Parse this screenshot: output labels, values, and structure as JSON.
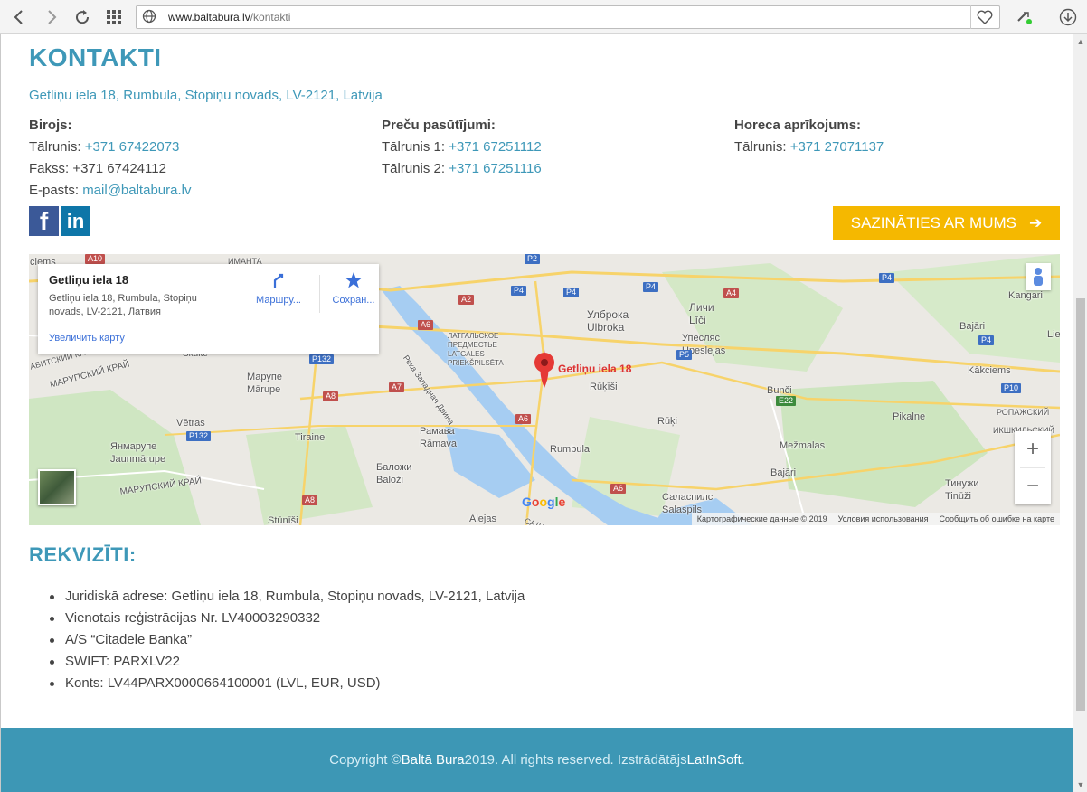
{
  "browser": {
    "url_host": "www.baltabura.lv",
    "url_path": "/kontakti"
  },
  "page": {
    "title": "KONTAKTI",
    "address": "Getliņu iela 18, Rumbula, Stopiņu novads, LV-2121, Latvija",
    "office": {
      "heading": "Birojs:",
      "phone_label": "Tālrunis: ",
      "phone": "+371 67422073",
      "fax": "Fakss: +371 67424112",
      "email_label": "E-pasts: ",
      "email": "mail@baltabura.lv"
    },
    "orders": {
      "heading": "Preču pasūtījumi:",
      "phone1_label": "Tālrunis 1: ",
      "phone1": "+371 67251112",
      "phone2_label": "Tālrunis 2: ",
      "phone2": "+371 67251116"
    },
    "horeca": {
      "heading": "Horeca aprīkojums:",
      "phone_label": "Tālrunis: ",
      "phone": "+371 27071137"
    },
    "social": {
      "facebook": "f",
      "linkedin": "in"
    },
    "contact_button": "SAZINĀTIES AR MUMS",
    "contact_arrow": "➔",
    "map": {
      "card_title": "Getliņu iela 18",
      "card_address": "Getliņu iela 18, Rumbula, Stopiņu novads, LV-2121, Латвия",
      "route_label": "Маршру...",
      "save_label": "Сохран...",
      "enlarge": "Увеличить карту",
      "pin_label": "Getliņu iela 18",
      "zoom_in": "+",
      "zoom_out": "−",
      "google": "Google",
      "footer_data": "Картографические данные © 2019",
      "footer_terms": "Условия использования",
      "footer_report": "Сообщить об ошибке на карте",
      "place_labels": [
        {
          "text": "Личи",
          "key": "p1"
        },
        {
          "text": "Līči",
          "key": "p2"
        },
        {
          "text": "Улброка",
          "key": "p3"
        },
        {
          "text": "Ulbroka",
          "key": "p4"
        },
        {
          "text": "Kangari",
          "key": "p5"
        },
        {
          "text": "Bajāri",
          "key": "p6"
        },
        {
          "text": "Упесляс",
          "key": "p7"
        },
        {
          "text": "Upeslejas",
          "key": "p8"
        },
        {
          "text": "Kākciems",
          "key": "p9"
        },
        {
          "text": "Rūķīši",
          "key": "p10"
        },
        {
          "text": "Rūķi",
          "key": "p11"
        },
        {
          "text": "Bunči",
          "key": "p12"
        },
        {
          "text": "Pikalne",
          "key": "p13"
        },
        {
          "text": "Mežmalas",
          "key": "p14"
        },
        {
          "text": "Bajāri",
          "key": "p15"
        },
        {
          "text": "Rumbula",
          "key": "p16"
        },
        {
          "text": "Рамава",
          "key": "p17"
        },
        {
          "text": "Rāmava",
          "key": "p18"
        },
        {
          "text": "Tiraine",
          "key": "p19"
        },
        {
          "text": "Марупе",
          "key": "p20"
        },
        {
          "text": "Mārupe",
          "key": "p21"
        },
        {
          "text": "Vētras",
          "key": "p22"
        },
        {
          "text": "Янмарупе",
          "key": "p23"
        },
        {
          "text": "Jaunmārupe",
          "key": "p24"
        },
        {
          "text": "Баложи",
          "key": "p25"
        },
        {
          "text": "Baloži",
          "key": "p26"
        },
        {
          "text": "Саласпилс",
          "key": "p27"
        },
        {
          "text": "Salaspils",
          "key": "p28"
        },
        {
          "text": "Тинужи",
          "key": "p29"
        },
        {
          "text": "Tinūži",
          "key": "p30"
        },
        {
          "text": "Alejas",
          "key": "p31"
        },
        {
          "text": "Stūnīši",
          "key": "p32"
        },
        {
          "text": "ЛАТГАЛЬСКОЕ",
          "key": "p33"
        },
        {
          "text": "ПРЕДМЕСТЬЕ",
          "key": "p34"
        },
        {
          "text": "LATGALES",
          "key": "p35"
        },
        {
          "text": "PRIEKŠPILSĒTA",
          "key": "p36"
        },
        {
          "text": "МАРУПСКИЙ КРАЙ",
          "key": "p37"
        },
        {
          "text": "МАРУПСКИЙ КРАЙ",
          "key": "p38"
        },
        {
          "text": "РОПАЖСКИЙ",
          "key": "p39"
        },
        {
          "text": "ИКШКИЛЬСКИЙ",
          "key": "p40"
        },
        {
          "text": "Река Западная Двина",
          "key": "p41"
        },
        {
          "text": "Lie",
          "key": "p42"
        },
        {
          "text": "ciems",
          "key": "p43"
        },
        {
          "text": "ИМАНТА",
          "key": "p44"
        },
        {
          "text": "Skulte",
          "key": "p45"
        },
        {
          "text": "АБИТСКИЙ КРАЙ",
          "key": "p46"
        },
        {
          "text": "САЛАС",
          "key": "p47"
        }
      ],
      "road_shields": [
        "A10",
        "P2",
        "A2",
        "P4",
        "P4",
        "P4",
        "P4",
        "A4",
        "P4",
        "A6",
        "P132",
        "A8",
        "A7",
        "P5",
        "E22",
        "P10",
        "A6",
        "P132",
        "A8",
        "A6"
      ]
    },
    "requisites_title": "REKVIZĪTI:",
    "requisites": [
      "Juridiskā adrese: Getliņu iela 18, Rumbula, Stopiņu novads, LV-2121, Latvija",
      "Vienotais reģistrācijas Nr. LV40003290332",
      "A/S “Citadele Banka”",
      "SWIFT: PARXLV22",
      "Konts: LV44PARX0000664100001 (LVL, EUR, USD)"
    ],
    "footer": {
      "prefix": "Copyright © ",
      "brand": "Baltā Bura",
      "middle": " 2019. All rights reserved. Izstrādātājs ",
      "developer": "LatInSoft",
      "suffix": "."
    }
  }
}
